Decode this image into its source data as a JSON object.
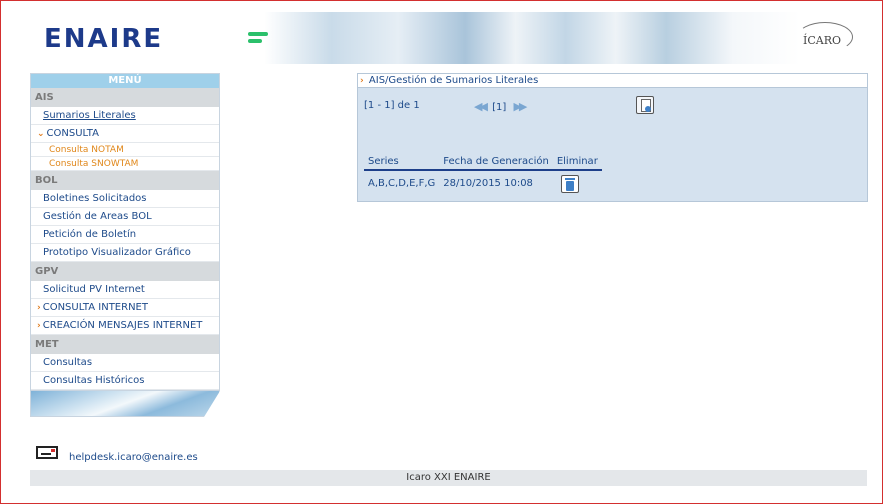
{
  "header": {
    "logo_text": "ENAIRE",
    "right_logo_text": "ÍCARO"
  },
  "sidebar": {
    "menu_title": "MENÚ",
    "sections": [
      {
        "title": "AIS",
        "items": [
          {
            "label": "Sumarios Literales"
          },
          {
            "label": "CONSULTA"
          },
          {
            "label": "Consulta NOTAM"
          },
          {
            "label": "Consulta SNOWTAM"
          }
        ]
      },
      {
        "title": "BOL",
        "items": [
          {
            "label": "Boletines Solicitados"
          },
          {
            "label": "Gestión de Areas BOL"
          },
          {
            "label": "Petición de Boletín"
          },
          {
            "label": "Prototipo Visualizador Gráfico"
          }
        ]
      },
      {
        "title": "GPV",
        "items": [
          {
            "label": "Solicitud PV Internet"
          },
          {
            "label": "CONSULTA INTERNET"
          },
          {
            "label": "CREACIÓN MENSAJES INTERNET"
          }
        ]
      },
      {
        "title": "MET",
        "items": [
          {
            "label": "Consultas"
          },
          {
            "label": "Consultas Históricos"
          }
        ]
      }
    ]
  },
  "main": {
    "breadcrumb": "AIS/Gestión de Sumarios Literales",
    "pager": {
      "range": "[1 - 1] de 1",
      "current_page": "[1]"
    },
    "table": {
      "headers": [
        "Series",
        "Fecha de Generación",
        "Eliminar"
      ],
      "rows": [
        {
          "series": "A,B,C,D,E,F,G",
          "fecha": "28/10/2015 10:08"
        }
      ]
    }
  },
  "helpdesk": {
    "email": "helpdesk.icaro@enaire.es"
  },
  "footer": {
    "text": "Icaro XXI ENAIRE"
  },
  "colors": {
    "accent_blue": "#1d4a8a",
    "menu_header": "#9fd0ea",
    "submenu_orange": "#e0871a",
    "frame_red": "#d32f2f"
  }
}
